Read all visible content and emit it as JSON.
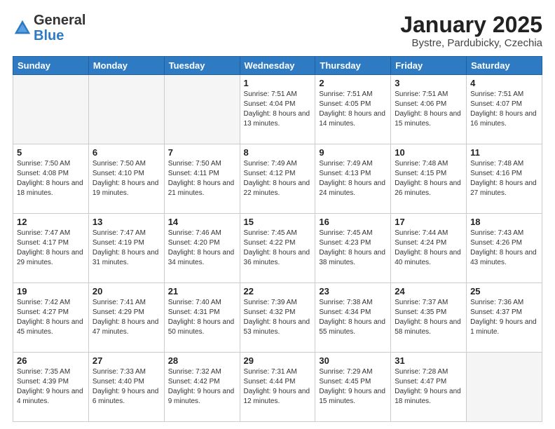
{
  "header": {
    "logo_general": "General",
    "logo_blue": "Blue",
    "month_title": "January 2025",
    "location": "Bystre, Pardubicky, Czechia"
  },
  "days_of_week": [
    "Sunday",
    "Monday",
    "Tuesday",
    "Wednesday",
    "Thursday",
    "Friday",
    "Saturday"
  ],
  "weeks": [
    [
      {
        "day": "",
        "info": ""
      },
      {
        "day": "",
        "info": ""
      },
      {
        "day": "",
        "info": ""
      },
      {
        "day": "1",
        "info": "Sunrise: 7:51 AM\nSunset: 4:04 PM\nDaylight: 8 hours\nand 13 minutes."
      },
      {
        "day": "2",
        "info": "Sunrise: 7:51 AM\nSunset: 4:05 PM\nDaylight: 8 hours\nand 14 minutes."
      },
      {
        "day": "3",
        "info": "Sunrise: 7:51 AM\nSunset: 4:06 PM\nDaylight: 8 hours\nand 15 minutes."
      },
      {
        "day": "4",
        "info": "Sunrise: 7:51 AM\nSunset: 4:07 PM\nDaylight: 8 hours\nand 16 minutes."
      }
    ],
    [
      {
        "day": "5",
        "info": "Sunrise: 7:50 AM\nSunset: 4:08 PM\nDaylight: 8 hours\nand 18 minutes."
      },
      {
        "day": "6",
        "info": "Sunrise: 7:50 AM\nSunset: 4:10 PM\nDaylight: 8 hours\nand 19 minutes."
      },
      {
        "day": "7",
        "info": "Sunrise: 7:50 AM\nSunset: 4:11 PM\nDaylight: 8 hours\nand 21 minutes."
      },
      {
        "day": "8",
        "info": "Sunrise: 7:49 AM\nSunset: 4:12 PM\nDaylight: 8 hours\nand 22 minutes."
      },
      {
        "day": "9",
        "info": "Sunrise: 7:49 AM\nSunset: 4:13 PM\nDaylight: 8 hours\nand 24 minutes."
      },
      {
        "day": "10",
        "info": "Sunrise: 7:48 AM\nSunset: 4:15 PM\nDaylight: 8 hours\nand 26 minutes."
      },
      {
        "day": "11",
        "info": "Sunrise: 7:48 AM\nSunset: 4:16 PM\nDaylight: 8 hours\nand 27 minutes."
      }
    ],
    [
      {
        "day": "12",
        "info": "Sunrise: 7:47 AM\nSunset: 4:17 PM\nDaylight: 8 hours\nand 29 minutes."
      },
      {
        "day": "13",
        "info": "Sunrise: 7:47 AM\nSunset: 4:19 PM\nDaylight: 8 hours\nand 31 minutes."
      },
      {
        "day": "14",
        "info": "Sunrise: 7:46 AM\nSunset: 4:20 PM\nDaylight: 8 hours\nand 34 minutes."
      },
      {
        "day": "15",
        "info": "Sunrise: 7:45 AM\nSunset: 4:22 PM\nDaylight: 8 hours\nand 36 minutes."
      },
      {
        "day": "16",
        "info": "Sunrise: 7:45 AM\nSunset: 4:23 PM\nDaylight: 8 hours\nand 38 minutes."
      },
      {
        "day": "17",
        "info": "Sunrise: 7:44 AM\nSunset: 4:24 PM\nDaylight: 8 hours\nand 40 minutes."
      },
      {
        "day": "18",
        "info": "Sunrise: 7:43 AM\nSunset: 4:26 PM\nDaylight: 8 hours\nand 43 minutes."
      }
    ],
    [
      {
        "day": "19",
        "info": "Sunrise: 7:42 AM\nSunset: 4:27 PM\nDaylight: 8 hours\nand 45 minutes."
      },
      {
        "day": "20",
        "info": "Sunrise: 7:41 AM\nSunset: 4:29 PM\nDaylight: 8 hours\nand 47 minutes."
      },
      {
        "day": "21",
        "info": "Sunrise: 7:40 AM\nSunset: 4:31 PM\nDaylight: 8 hours\nand 50 minutes."
      },
      {
        "day": "22",
        "info": "Sunrise: 7:39 AM\nSunset: 4:32 PM\nDaylight: 8 hours\nand 53 minutes."
      },
      {
        "day": "23",
        "info": "Sunrise: 7:38 AM\nSunset: 4:34 PM\nDaylight: 8 hours\nand 55 minutes."
      },
      {
        "day": "24",
        "info": "Sunrise: 7:37 AM\nSunset: 4:35 PM\nDaylight: 8 hours\nand 58 minutes."
      },
      {
        "day": "25",
        "info": "Sunrise: 7:36 AM\nSunset: 4:37 PM\nDaylight: 9 hours\nand 1 minute."
      }
    ],
    [
      {
        "day": "26",
        "info": "Sunrise: 7:35 AM\nSunset: 4:39 PM\nDaylight: 9 hours\nand 4 minutes."
      },
      {
        "day": "27",
        "info": "Sunrise: 7:33 AM\nSunset: 4:40 PM\nDaylight: 9 hours\nand 6 minutes."
      },
      {
        "day": "28",
        "info": "Sunrise: 7:32 AM\nSunset: 4:42 PM\nDaylight: 9 hours\nand 9 minutes."
      },
      {
        "day": "29",
        "info": "Sunrise: 7:31 AM\nSunset: 4:44 PM\nDaylight: 9 hours\nand 12 minutes."
      },
      {
        "day": "30",
        "info": "Sunrise: 7:29 AM\nSunset: 4:45 PM\nDaylight: 9 hours\nand 15 minutes."
      },
      {
        "day": "31",
        "info": "Sunrise: 7:28 AM\nSunset: 4:47 PM\nDaylight: 9 hours\nand 18 minutes."
      },
      {
        "day": "",
        "info": ""
      }
    ]
  ]
}
